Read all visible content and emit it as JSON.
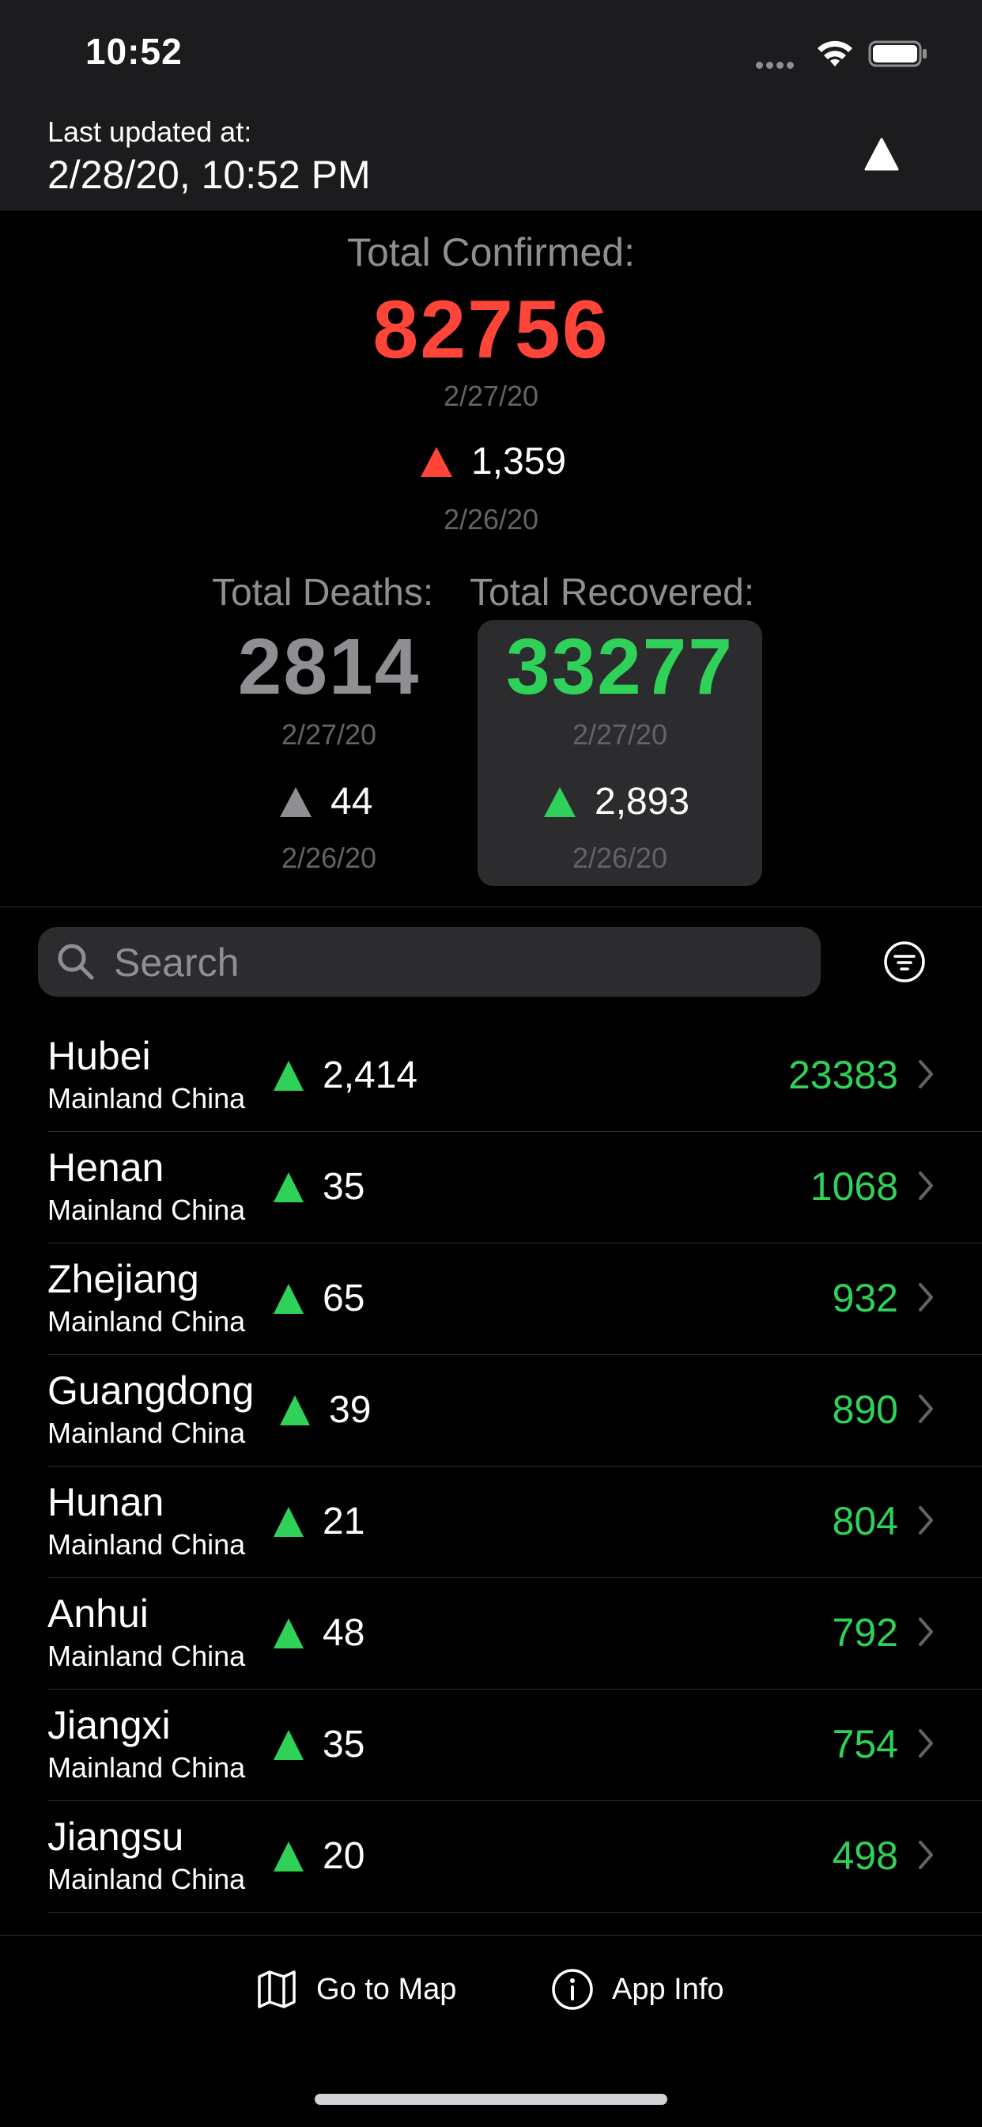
{
  "status_bar": {
    "time": "10:52"
  },
  "header": {
    "last_updated_label": "Last updated at:",
    "last_updated_value": "2/28/20, 10:52 PM",
    "action_icon": "triangle-up-icon"
  },
  "summary": {
    "confirmed": {
      "label": "Total Confirmed:",
      "value": "82756",
      "date": "2/27/20",
      "delta": "1,359",
      "delta_date": "2/26/20",
      "color": "#ff453a"
    },
    "deaths": {
      "label": "Total Deaths:",
      "value": "2814",
      "date": "2/27/20",
      "delta": "44",
      "delta_date": "2/26/20",
      "color": "#8e8e93"
    },
    "recovered": {
      "label": "Total Recovered:",
      "value": "33277",
      "date": "2/27/20",
      "delta": "2,893",
      "delta_date": "2/26/20",
      "color": "#30d158",
      "selected": true
    }
  },
  "search": {
    "placeholder": "Search",
    "value": ""
  },
  "regions": [
    {
      "name": "Hubei",
      "country": "Mainland China",
      "delta": "2,414",
      "value": "23383"
    },
    {
      "name": "Henan",
      "country": "Mainland China",
      "delta": "35",
      "value": "1068"
    },
    {
      "name": "Zhejiang",
      "country": "Mainland China",
      "delta": "65",
      "value": "932"
    },
    {
      "name": "Guangdong",
      "country": "Mainland China",
      "delta": "39",
      "value": "890"
    },
    {
      "name": "Hunan",
      "country": "Mainland China",
      "delta": "21",
      "value": "804"
    },
    {
      "name": "Anhui",
      "country": "Mainland China",
      "delta": "48",
      "value": "792"
    },
    {
      "name": "Jiangxi",
      "country": "Mainland China",
      "delta": "35",
      "value": "754"
    },
    {
      "name": "Jiangsu",
      "country": "Mainland China",
      "delta": "20",
      "value": "498"
    }
  ],
  "bottom_bar": {
    "map_label": "Go to Map",
    "map_icon": "map-icon",
    "info_label": "App Info",
    "info_icon": "info-icon"
  },
  "colors": {
    "accent_green": "#30d158",
    "accent_red": "#ff453a",
    "gray": "#8e8e93"
  }
}
